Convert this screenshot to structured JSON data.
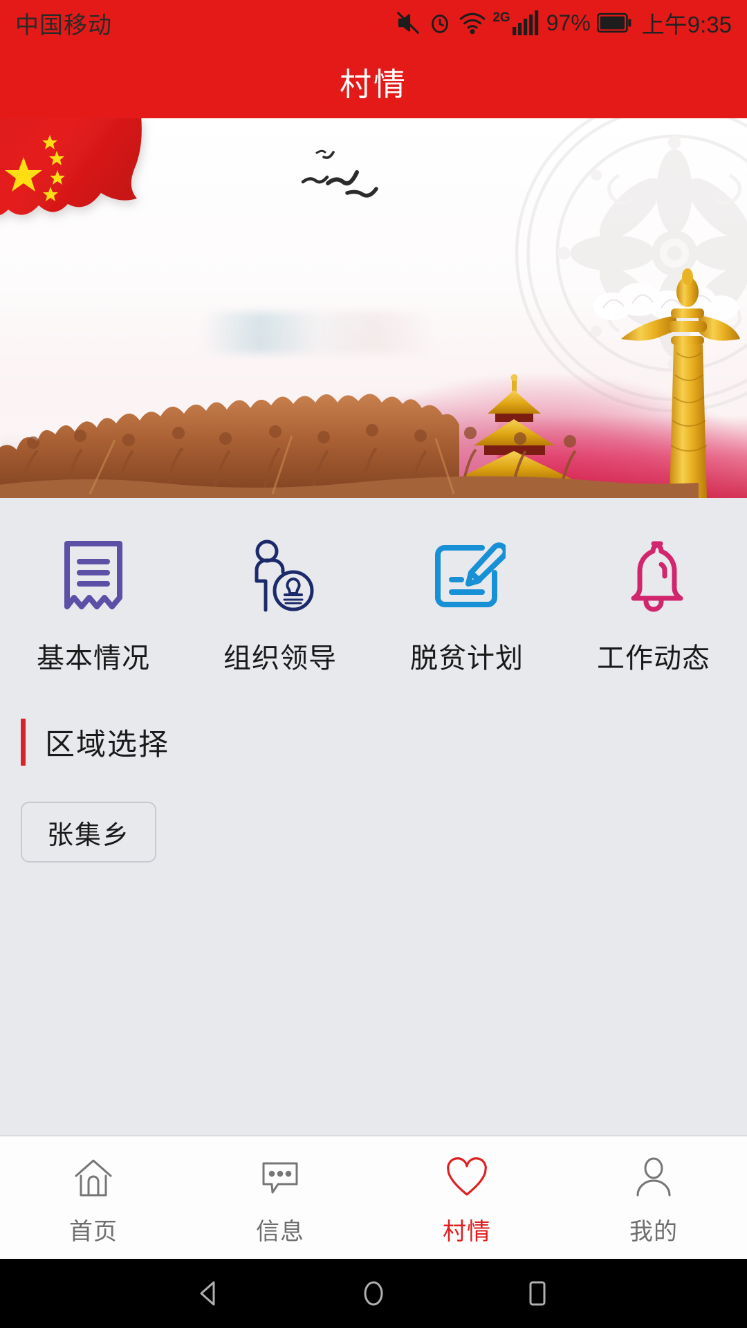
{
  "status_bar": {
    "carrier": "中国移动",
    "network_type": "2G",
    "battery_percent": "97%",
    "time": "上午9:35",
    "icons": [
      "mute-icon",
      "alarm-icon",
      "wifi-icon",
      "signal-icon",
      "battery-icon"
    ]
  },
  "header": {
    "title": "村情"
  },
  "banner": {
    "alt": "党建宣传横幅",
    "elements": [
      "china-flag",
      "flying-birds",
      "paper-cut-mandala",
      "monument-relief",
      "temple-of-heaven",
      "golden-pillar",
      "clouds"
    ]
  },
  "tiles": [
    {
      "label": "基本情况",
      "icon": "receipt-icon",
      "color": "#5b50a6"
    },
    {
      "label": "组织领导",
      "icon": "person-stamp-icon",
      "color": "#1c2a6b"
    },
    {
      "label": "脱贫计划",
      "icon": "document-pencil-icon",
      "color": "#1890d5"
    },
    {
      "label": "工作动态",
      "icon": "bell-icon",
      "color": "#d1256e"
    }
  ],
  "region_section": {
    "title": "区域选择",
    "accent_color": "#d8232a",
    "options": [
      {
        "label": "张集乡"
      }
    ]
  },
  "tab_bar": {
    "active_color": "#dd2020",
    "inactive_color": "#6e6e6e",
    "tabs": [
      {
        "label": "首页",
        "icon": "home-icon",
        "active": false
      },
      {
        "label": "信息",
        "icon": "chat-icon",
        "active": false
      },
      {
        "label": "村情",
        "icon": "heart-icon",
        "active": true
      },
      {
        "label": "我的",
        "icon": "person-icon",
        "active": false
      }
    ]
  },
  "android_nav": {
    "buttons": [
      {
        "name": "back-button"
      },
      {
        "name": "home-button"
      },
      {
        "name": "recents-button"
      }
    ]
  }
}
